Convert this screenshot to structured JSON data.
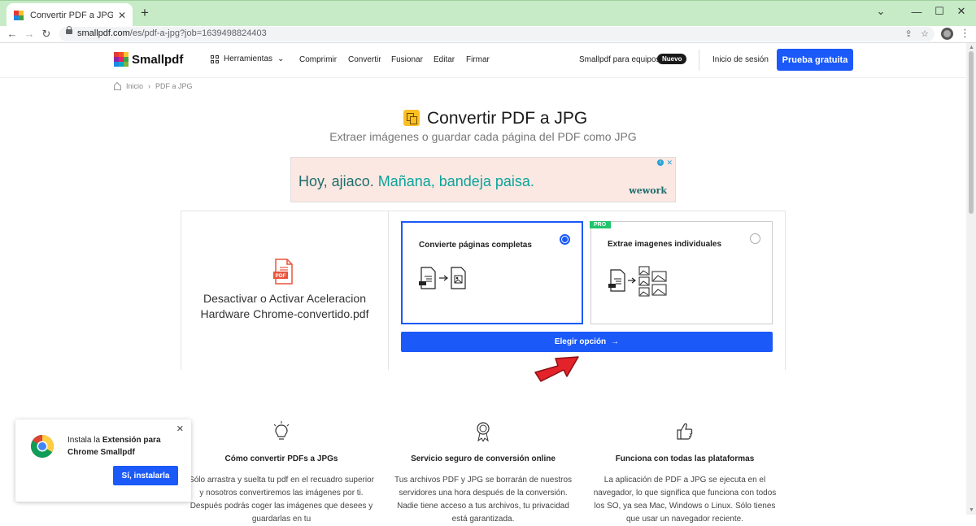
{
  "browser": {
    "tab_title": "Convertir PDF a JPG – Convierte",
    "tab_close": "✕",
    "new_tab": "+",
    "url_host": "smallpdf.com",
    "url_path": "/es/pdf-a-jpg?job=1639498824403",
    "window_controls": [
      "⌄",
      "—",
      "☐",
      "✕"
    ]
  },
  "header": {
    "logo": "Smallpdf",
    "tools_label": "Herramientas",
    "nav": [
      "Comprimir",
      "Convertir",
      "Fusionar",
      "Editar",
      "Firmar"
    ],
    "teams_label": "Smallpdf para equipos",
    "new_badge": "Nuevo",
    "login": "Inicio de sesión",
    "trial": "Prueba gratuita"
  },
  "breadcrumb": {
    "home": "Inicio",
    "sep": "›",
    "current": "PDF a JPG"
  },
  "hero": {
    "title": "Convertir PDF a JPG",
    "subtitle": "Extraer imágenes o guardar cada página del PDF como JPG"
  },
  "ad": {
    "text_a": "Hoy, ajiaco. ",
    "text_b": "Mañana, bandeja paisa.",
    "brand": "wework",
    "info": "i",
    "close": "✕"
  },
  "file": {
    "pdf_tag": "PDF",
    "name": "Desactivar o Activar Aceleracion Hardware Chrome-convertido.pdf"
  },
  "options": [
    {
      "label": "Convierte páginas completas",
      "selected": true
    },
    {
      "label": "Extrae imagenes individuales",
      "selected": false,
      "badge": "PRO"
    }
  ],
  "choose_button": "Elegir opción",
  "features": [
    {
      "icon": "lightbulb-icon",
      "title": "Cómo convertir PDFs a JPGs",
      "text": "Sólo arrastra y suelta tu pdf en el recuadro superior y nosotros convertiremos las imágenes por ti. Después podrás coger las imágenes que desees y guardarlas en tu"
    },
    {
      "icon": "award-icon",
      "title": "Servicio seguro de conversión online",
      "text": "Tus archivos PDF y JPG se borrarán de nuestros servidores una hora después de la conversión. Nadie tiene acceso a tus archivos, tu privacidad está garantizada."
    },
    {
      "icon": "thumbs-up-icon",
      "title": "Funciona con todas las plataformas",
      "text": "La aplicación de PDF a JPG se ejecuta en el navegador, lo que significa que funciona con todos los SO, ya sea Mac, Windows o Linux. Sólo tienes que usar un navegador reciente."
    }
  ],
  "extension": {
    "text_a": "Instala la ",
    "text_b": "Extensión para Chrome Smallpdf",
    "button": "Sí, instalarla",
    "close": "✕"
  },
  "colors": {
    "accent": "#1b59f8",
    "pro": "#20c46a",
    "title_icon": "#fbbf24",
    "pointer": "#e4222a"
  }
}
